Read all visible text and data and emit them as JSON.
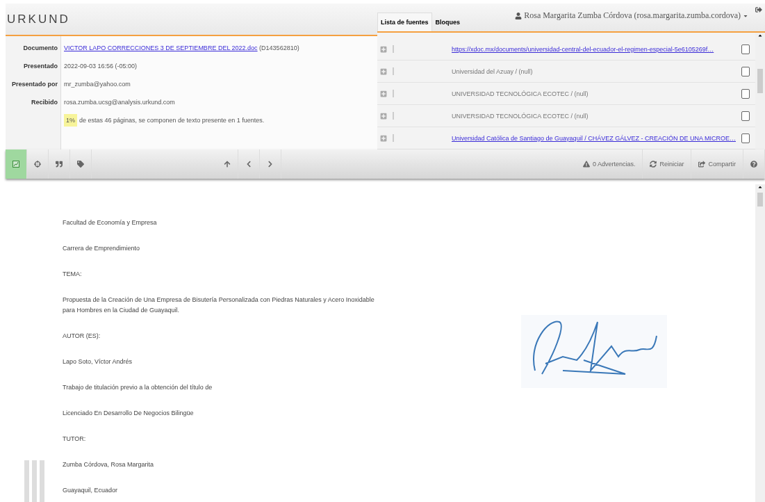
{
  "logo": "URKUND",
  "user": {
    "name": "Rosa Margarita Zumba Córdova (rosa.margarita.zumba.cordova)"
  },
  "info": [
    {
      "label": "Documento",
      "value": "VICTOR LAPO CORRECCIONES 3 DE SEPTIEMBRE DEL 2022.doc",
      "suffix": "(D143562810)",
      "kind": "link"
    },
    {
      "label": "Presentado",
      "value": "2022-09-03 16:56 (-05:00)",
      "kind": "text"
    },
    {
      "label": "Presentado por",
      "value": "mr_zumba@yahoo.com",
      "kind": "text"
    },
    {
      "label": "Recibido",
      "value": "rosa.zumba.ucsg@analysis.urkund.com",
      "kind": "text"
    }
  ],
  "summary": {
    "percent": "1%",
    "text": "de estas 46 páginas, se componen de texto presente en 1 fuentes."
  },
  "tabs": [
    {
      "label": "Lista de fuentes",
      "selected": true
    },
    {
      "label": "Bloques",
      "selected": false
    }
  ],
  "sources": [
    {
      "text": "https://xdoc.mx/documents/universidad-central-del-ecuador-el-regimen-especial-5e6105269f…",
      "kind": "link",
      "checked": false
    },
    {
      "text": "Universidad del Azuay / (null)",
      "kind": "plain",
      "checked": false
    },
    {
      "text": "UNIVERSIDAD TECNOLÓGICA ECOTEC / (null)",
      "kind": "plain",
      "checked": false
    },
    {
      "text": "UNIVERSIDAD TECNOLÓGICA ECOTEC / (null)",
      "kind": "plain",
      "checked": false
    },
    {
      "text": "Universidad Católica de Santiago de Guayaquil / CHÁVEZ GÁLVEZ - CREACIÓN DE UNA MICROE…",
      "kind": "link",
      "checked": false
    }
  ],
  "toolbar": {
    "warnings": "0 Advertencias.",
    "restart": "Reiniciar",
    "share": "Compartir"
  },
  "document": {
    "lines": [
      "Facultad de Economía y Empresa",
      "Carrera de Emprendimiento",
      "TEMA:",
      "Propuesta de la Creación de Una Empresa de Bisutería Personalizada con Piedras Naturales y Acero Inoxidable para Hombres en la Ciudad de Guayaquil.",
      "AUTOR (ES):",
      "Lapo Soto, Víctor Andrés",
      "Trabajo de titulación previo a la obtención del título de",
      "Licenciado En Desarrollo De Negocios Bilingüe",
      "TUTOR:",
      "Zumba Córdova, Rosa Margarita",
      "Guayaquil, Ecuador"
    ]
  }
}
